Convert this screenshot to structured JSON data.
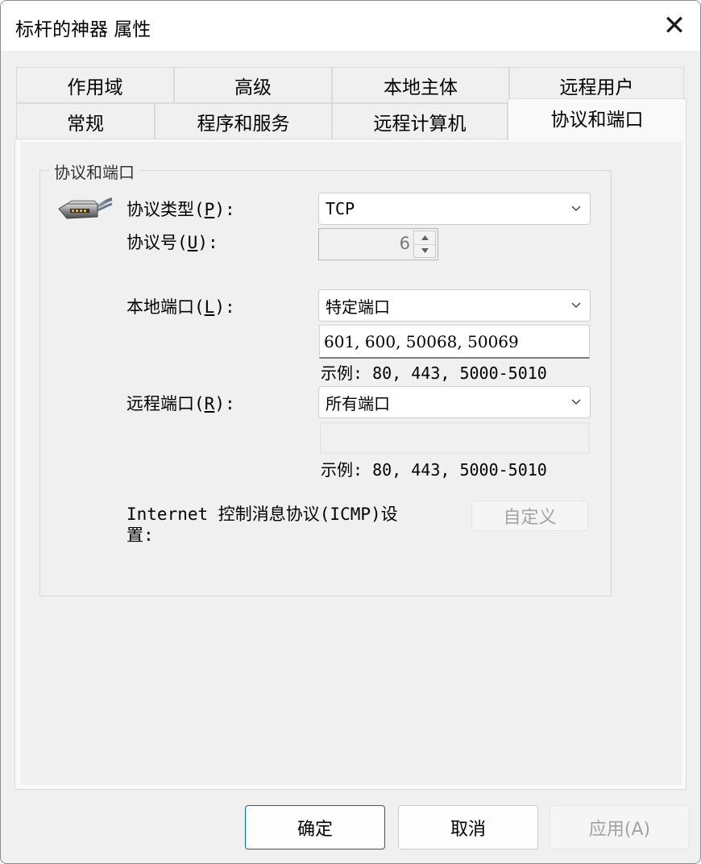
{
  "window": {
    "title": "标杆的神器 属性",
    "close_glyph": "✕"
  },
  "tabs": {
    "row1": [
      "作用域",
      "高级",
      "本地主体",
      "远程用户"
    ],
    "row2": [
      "常规",
      "程序和服务",
      "远程计算机",
      "协议和端口"
    ],
    "active": "协议和端口"
  },
  "group": {
    "title": "协议和端口",
    "icon": "network-plug-icon"
  },
  "protocol_type": {
    "label_prefix": "协议类型(",
    "label_key": "P",
    "label_suffix": "):",
    "value": "TCP"
  },
  "protocol_number": {
    "label_prefix": "协议号(",
    "label_key": "U",
    "label_suffix": "):",
    "value": "6"
  },
  "local_port": {
    "label_prefix": "本地端口(",
    "label_key": "L",
    "label_suffix": "):",
    "select_value": "特定端口",
    "ports_value": "601, 600, 50068, 50069",
    "example": "示例: 80, 443, 5000-5010"
  },
  "remote_port": {
    "label_prefix": "远程端口(",
    "label_key": "R",
    "label_suffix": "):",
    "select_value": "所有端口",
    "ports_value": "",
    "example": "示例: 80, 443, 5000-5010"
  },
  "icmp": {
    "label_line1": "Internet 控制消息协议(ICMP)设",
    "label_line2": "置:",
    "button_label": "自定义"
  },
  "footer": {
    "ok_label": "确定",
    "cancel_label": "取消",
    "apply_label": "应用(A)"
  }
}
